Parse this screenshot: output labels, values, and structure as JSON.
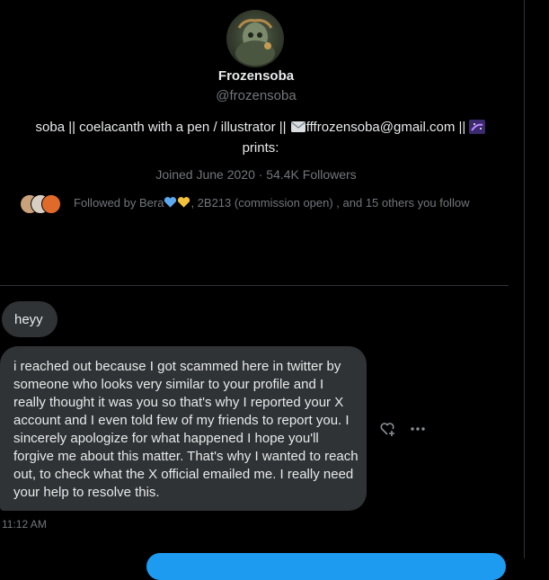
{
  "profile": {
    "display_name": "Frozensoba",
    "handle": "@frozensoba",
    "bio_line1_a": "soba || coelacanth with a pen / illustrator || ",
    "bio_line1_b": "fffrozensoba@gmail.com || ",
    "bio_line2": "prints:",
    "joined": "Joined June 2020 · 54.4K Followers",
    "followed_prefix": "Followed by Bera",
    "followed_suffix": ", 2B213 (commission open) , and 15 others you follow"
  },
  "messages": [
    {
      "text": "heyy"
    },
    {
      "text": "i  reached out because I got scammed here in twitter by someone who looks very similar to your profile and I really thought it was you so that's why I reported your X account and I even told few of my friends to report you. I sincerely apologize for what happened I hope you'll forgive me about this matter. That's why I wanted to reach out, to check what the X official emailed me. I really need your help to resolve this."
    }
  ],
  "timestamp": "11:12 AM",
  "icons": [
    "avatar",
    "envelope-icon",
    "galaxy-icon",
    "blue-heart-icon",
    "yellow-heart-icon",
    "add-reaction-icon",
    "more-icon"
  ]
}
